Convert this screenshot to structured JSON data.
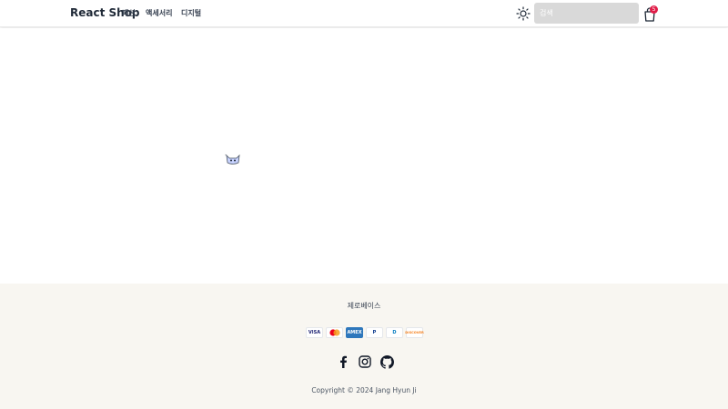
{
  "header": {
    "brand": "React Shop",
    "nav": [
      "패션",
      "액세서리",
      "디지털"
    ],
    "search_placeholder": "검색",
    "cart_count": "5"
  },
  "footer": {
    "link": "제로베이스",
    "payments": [
      {
        "name": "visa-icon",
        "label": "VISA",
        "color": "#1a1f71"
      },
      {
        "name": "mastercard-icon",
        "label": "",
        "color": "#eb001b"
      },
      {
        "name": "amex-icon",
        "label": "AMEX",
        "color": "#2e77bc"
      },
      {
        "name": "paypal-icon",
        "label": "P",
        "color": "#003087"
      },
      {
        "name": "diners-icon",
        "label": "D",
        "color": "#0079be"
      },
      {
        "name": "discover-icon",
        "label": "DISCOVER",
        "color": "#f58220"
      }
    ],
    "socials": [
      "facebook-icon",
      "instagram-icon",
      "github-icon"
    ],
    "copyright": "Copyright © 2024 Jang Hyun Ji"
  },
  "colors": {
    "footer_bg": "#f8f6f1",
    "badge": "#e11d48",
    "search_bg": "#d9d9d9"
  }
}
